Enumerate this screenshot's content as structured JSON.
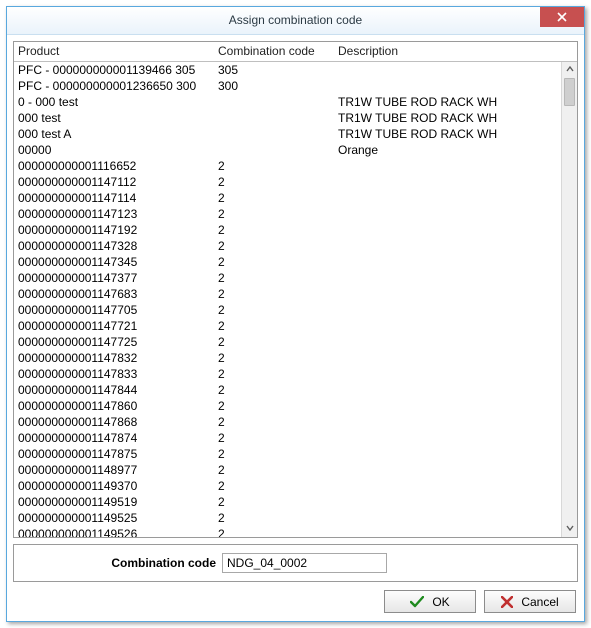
{
  "window": {
    "title": "Assign combination code"
  },
  "grid": {
    "headers": {
      "product": "Product",
      "code": "Combination code",
      "description": "Description"
    },
    "rows": [
      {
        "product": "PFC - 000000000001139466 305",
        "code": "305",
        "description": ""
      },
      {
        "product": "PFC - 000000000001236650 300",
        "code": "300",
        "description": ""
      },
      {
        "product": "0 - 000 test",
        "code": "",
        "description": "TR1W TUBE ROD RACK WH"
      },
      {
        "product": "000 test",
        "code": "",
        "description": "TR1W TUBE ROD RACK WH"
      },
      {
        "product": "000 test A",
        "code": "",
        "description": "TR1W TUBE ROD RACK WH"
      },
      {
        "product": "00000",
        "code": "",
        "description": "Orange"
      },
      {
        "product": "000000000001116652",
        "code": "2",
        "description": ""
      },
      {
        "product": "000000000001147112",
        "code": "2",
        "description": ""
      },
      {
        "product": "000000000001147114",
        "code": "2",
        "description": ""
      },
      {
        "product": "000000000001147123",
        "code": "2",
        "description": ""
      },
      {
        "product": "000000000001147192",
        "code": "2",
        "description": ""
      },
      {
        "product": "000000000001147328",
        "code": "2",
        "description": ""
      },
      {
        "product": "000000000001147345",
        "code": "2",
        "description": ""
      },
      {
        "product": "000000000001147377",
        "code": "2",
        "description": ""
      },
      {
        "product": "000000000001147683",
        "code": "2",
        "description": ""
      },
      {
        "product": "000000000001147705",
        "code": "2",
        "description": ""
      },
      {
        "product": "000000000001147721",
        "code": "2",
        "description": ""
      },
      {
        "product": "000000000001147725",
        "code": "2",
        "description": ""
      },
      {
        "product": "000000000001147832",
        "code": "2",
        "description": ""
      },
      {
        "product": "000000000001147833",
        "code": "2",
        "description": ""
      },
      {
        "product": "000000000001147844",
        "code": "2",
        "description": ""
      },
      {
        "product": "000000000001147860",
        "code": "2",
        "description": ""
      },
      {
        "product": "000000000001147868",
        "code": "2",
        "description": ""
      },
      {
        "product": "000000000001147874",
        "code": "2",
        "description": ""
      },
      {
        "product": "000000000001147875",
        "code": "2",
        "description": ""
      },
      {
        "product": "000000000001148977",
        "code": "2",
        "description": ""
      },
      {
        "product": "000000000001149370",
        "code": "2",
        "description": ""
      },
      {
        "product": "000000000001149519",
        "code": "2",
        "description": ""
      },
      {
        "product": "000000000001149525",
        "code": "2",
        "description": ""
      },
      {
        "product": "000000000001149526",
        "code": "2",
        "description": ""
      }
    ]
  },
  "form": {
    "label": "Combination code",
    "value": "NDG_04_0002"
  },
  "buttons": {
    "ok": "OK",
    "cancel": "Cancel"
  }
}
